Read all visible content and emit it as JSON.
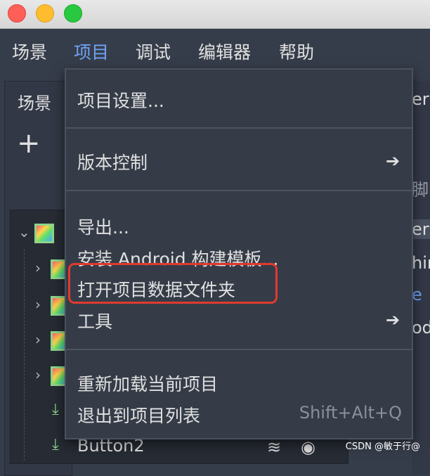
{
  "menubar": {
    "items": [
      "场景",
      "项目",
      "调试",
      "编辑器",
      "帮助"
    ]
  },
  "scene_dock": {
    "title": "场景",
    "add_label": "+",
    "node_button_label": "Button2"
  },
  "inspector_fragments": [
    "er",
    "脚",
    "er",
    "hir",
    "e",
    "od"
  ],
  "project_menu": {
    "project_settings": "项目设置...",
    "version_control": "版本控制",
    "export": "导出...",
    "install_android_template": "安装 Android 构建模板...",
    "open_data_folder": "打开项目数据文件夹",
    "tools": "工具",
    "reload_project": "重新加载当前项目",
    "quit_to_project_list": "退出到项目列表",
    "quit_shortcut": "Shift+Alt+Q"
  },
  "watermark": "CSDN @敏于行@",
  "colors": {
    "background": "#363d4a",
    "menu_active": "#6fa3f5",
    "highlight_box": "#e03a2e"
  }
}
